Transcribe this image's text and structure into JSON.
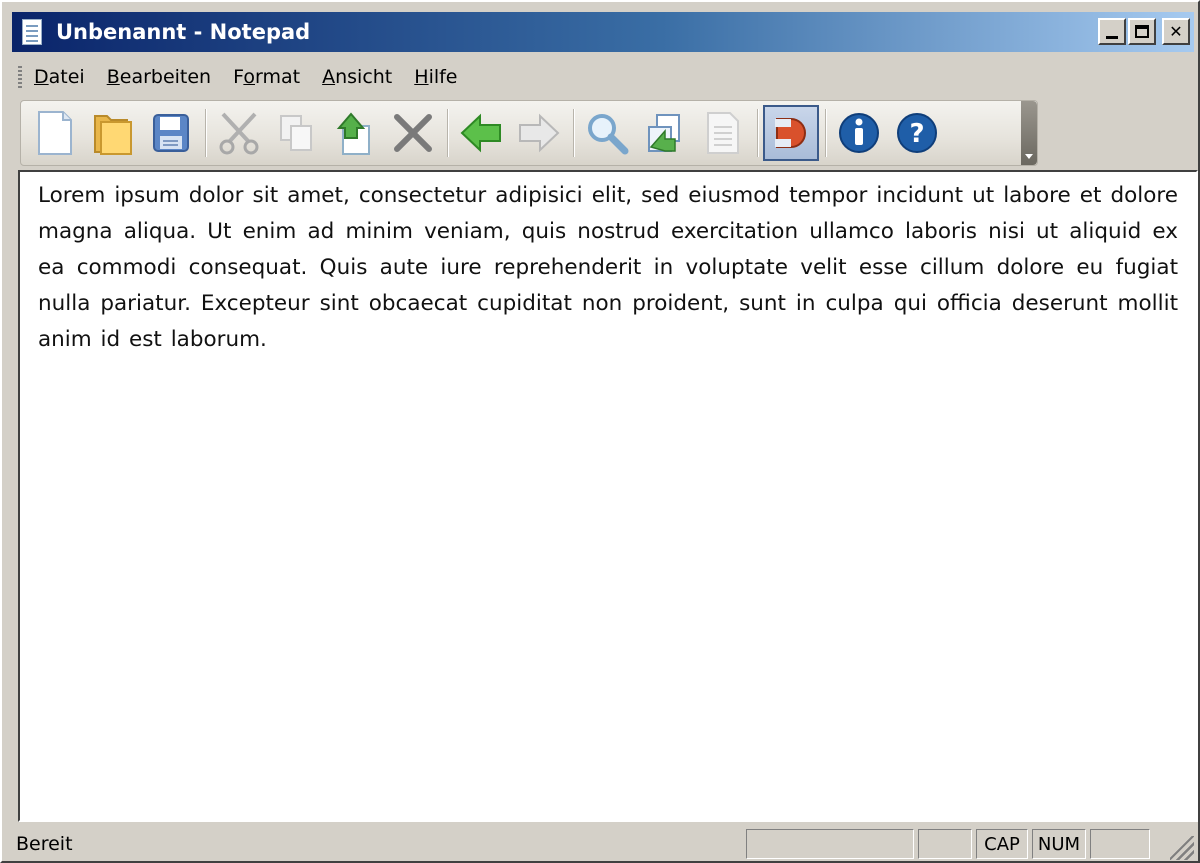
{
  "window": {
    "title": "Unbenannt - Notepad"
  },
  "menu": [
    {
      "label": "Datei",
      "accel": "D"
    },
    {
      "label": "Bearbeiten",
      "accel": "B"
    },
    {
      "label": "Format",
      "accel": "o"
    },
    {
      "label": "Ansicht",
      "accel": "A"
    },
    {
      "label": "Hilfe",
      "accel": "H"
    }
  ],
  "toolbar": {
    "buttons": [
      {
        "icon": "new-document-icon"
      },
      {
        "icon": "open-folder-icon"
      },
      {
        "icon": "save-icon"
      },
      {
        "icon": "cut-icon"
      },
      {
        "icon": "copy-icon"
      },
      {
        "icon": "paste-icon"
      },
      {
        "icon": "delete-icon"
      },
      {
        "icon": "undo-arrow-icon"
      },
      {
        "icon": "redo-arrow-icon"
      },
      {
        "icon": "find-icon"
      },
      {
        "icon": "replace-icon"
      },
      {
        "icon": "page-setup-icon"
      },
      {
        "icon": "word-wrap-icon",
        "pressed": true
      },
      {
        "icon": "info-icon"
      },
      {
        "icon": "help-icon"
      }
    ]
  },
  "editor": {
    "text": "Lorem ipsum dolor sit amet, consectetur adipisici elit, sed eiusmod tempor incidunt ut labore et dolore magna aliqua. Ut enim ad minim veniam, quis nostrud exercitation ullamco laboris nisi ut aliquid ex ea commodi consequat. Quis aute iure reprehenderit in voluptate velit esse cillum dolore eu fugiat nulla pariatur. Excepteur sint obcaecat cupiditat non proident, sunt in culpa qui officia deserunt mollit anim id est laborum."
  },
  "status": {
    "text": "Bereit",
    "cap": "CAP",
    "num": "NUM"
  },
  "colors": {
    "title_gradient_start": "#0a246a",
    "title_gradient_end": "#a6caf0",
    "face": "#d4d0c8"
  }
}
